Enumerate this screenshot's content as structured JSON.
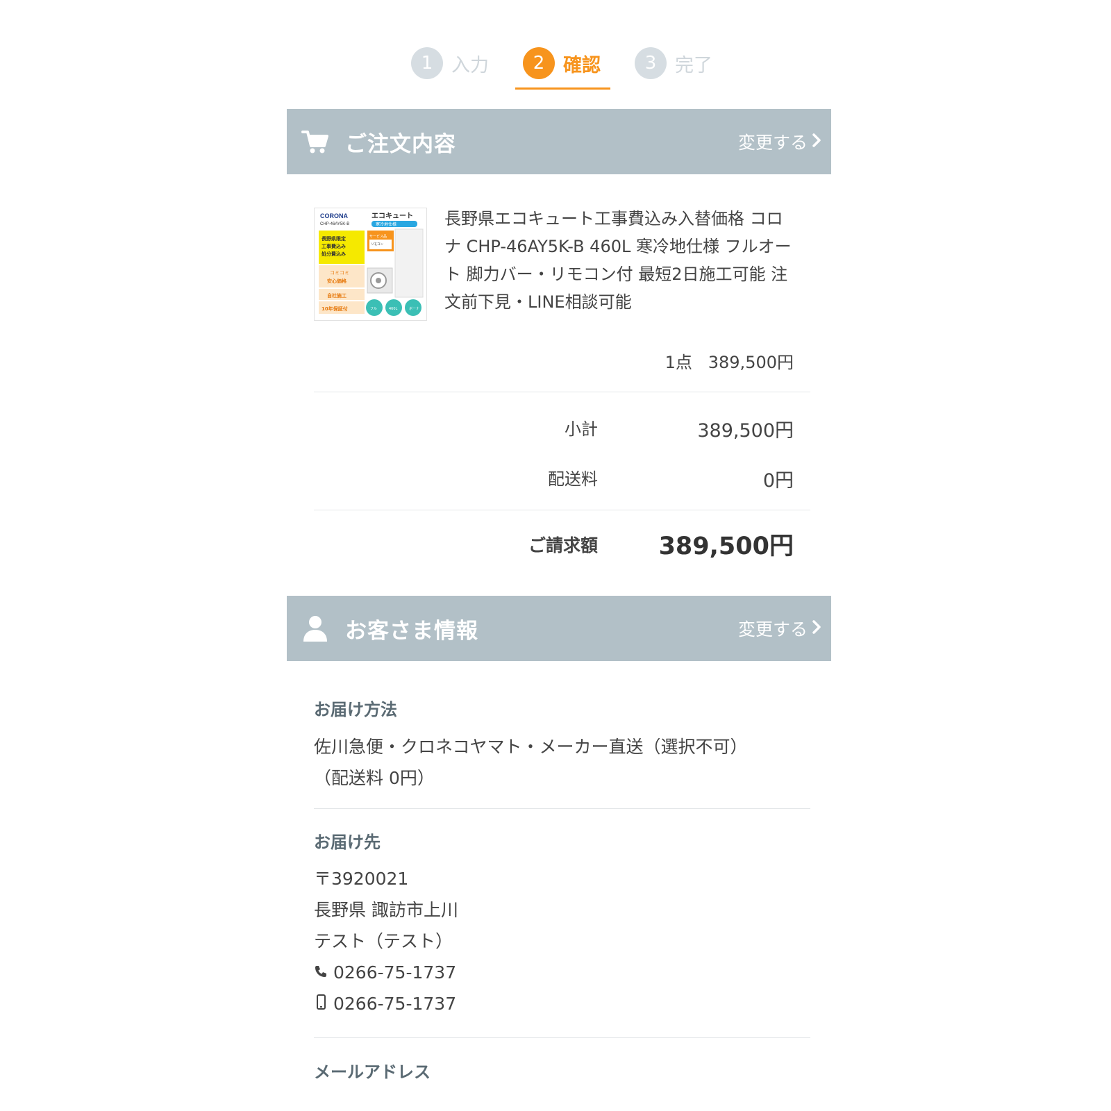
{
  "steps": [
    {
      "num": "1",
      "label": "入力"
    },
    {
      "num": "2",
      "label": "確認"
    },
    {
      "num": "3",
      "label": "完了"
    }
  ],
  "order_section": {
    "title": "ご注文内容",
    "change_label": "変更する",
    "icon": "cart-icon"
  },
  "product": {
    "title": "長野県エコキュート工事費込み入替価格 コロナ CHP-46AY5K-B 460L 寒冷地仕様 フルオート 脚力バー・リモコン付 最短2日施工可能 注文前下見・LINE相談可能",
    "quantity": "1点",
    "price": "389,500円",
    "thumb": {
      "brand": "CORONA",
      "model": "CHP-46AY5K-B",
      "heading": "エコキュート",
      "sub": "寒冷地仕様",
      "badge1": "長野県限定 工事費込み 処分費込み",
      "badge2": "コミコミ 安心価格",
      "badge3": "自社施工",
      "badge4": "10年保証付",
      "orange": "サービス品 リモコン 脚部カバー",
      "circles": [
        "フルオート",
        "460L",
        "ボーナス入荷"
      ]
    }
  },
  "summary": {
    "subtotal_label": "小計",
    "subtotal_value": "389,500円",
    "shipping_label": "配送料",
    "shipping_value": "0円",
    "total_label": "ご請求額",
    "total_value": "389,500円"
  },
  "customer_section": {
    "title": "お客さま情報",
    "change_label": "変更する",
    "icon": "user-icon"
  },
  "delivery_method": {
    "label": "お届け方法",
    "line1": "佐川急便・クロネコヤマト・メーカー直送（選択不可）",
    "line2": "（配送料 0円）"
  },
  "delivery_address": {
    "label": "お届け先",
    "postal": "〒3920021",
    "address": "長野県 諏訪市上川",
    "name": "テスト（テスト）",
    "phone": "0266-75-1737",
    "mobile": "0266-75-1737"
  },
  "email": {
    "label": "メールアドレス"
  },
  "colors": {
    "accent": "#f7941d",
    "header_bg": "#b2c0c7",
    "step_inactive": "#d6dde2"
  }
}
